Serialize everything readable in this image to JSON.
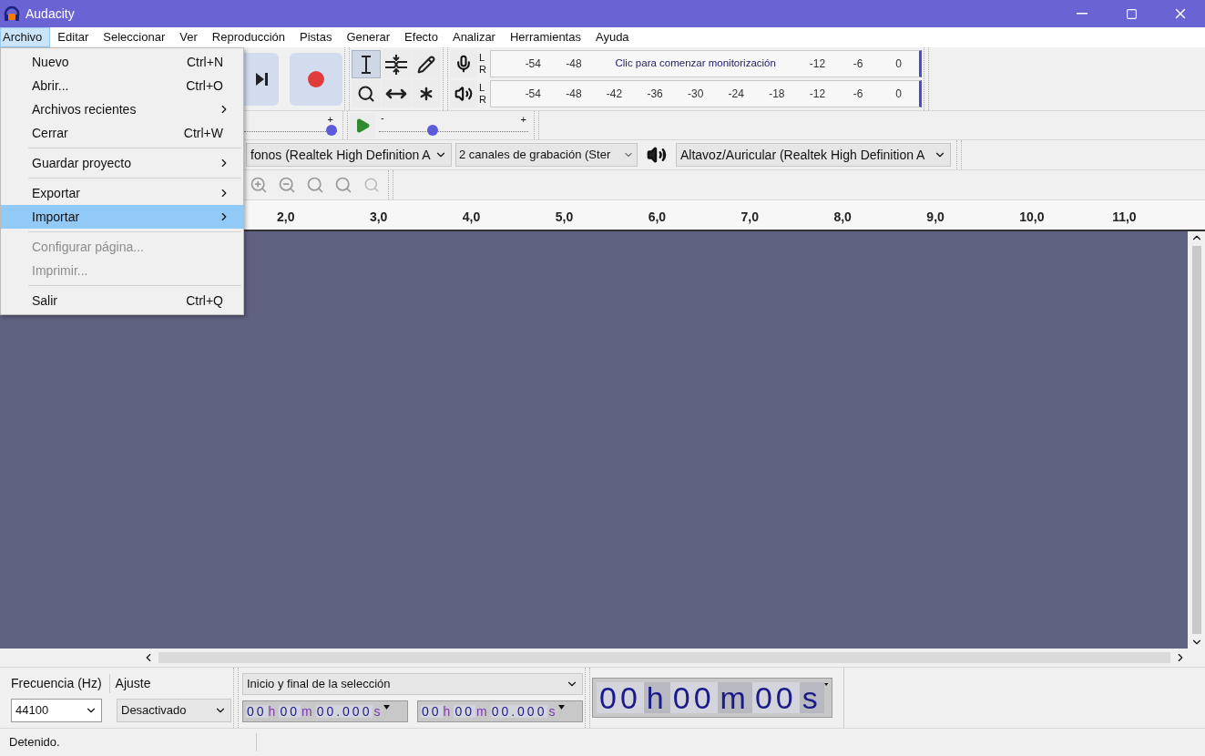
{
  "window": {
    "title": "Audacity"
  },
  "menubar": [
    {
      "label": "Archivo",
      "selected": true
    },
    {
      "label": "Editar",
      "selected": false
    },
    {
      "label": "Seleccionar",
      "selected": false
    },
    {
      "label": "Ver",
      "selected": false
    },
    {
      "label": "Reproducción",
      "selected": false
    },
    {
      "label": "Pistas",
      "selected": false
    },
    {
      "label": "Generar",
      "selected": false
    },
    {
      "label": "Efecto",
      "selected": false
    },
    {
      "label": "Analizar",
      "selected": false
    },
    {
      "label": "Herramientas",
      "selected": false
    },
    {
      "label": "Ayuda",
      "selected": false
    }
  ],
  "file_menu": [
    {
      "kind": "item",
      "label": "Nuevo",
      "shortcut": "Ctrl+N",
      "submenu": false,
      "disabled": false,
      "selected": false
    },
    {
      "kind": "item",
      "label": "Abrir...",
      "shortcut": "Ctrl+O",
      "submenu": false,
      "disabled": false,
      "selected": false
    },
    {
      "kind": "item",
      "label": "Archivos recientes",
      "submenu": true,
      "disabled": false,
      "selected": false
    },
    {
      "kind": "item",
      "label": "Cerrar",
      "shortcut": "Ctrl+W",
      "submenu": false,
      "disabled": false,
      "selected": false
    },
    {
      "kind": "separator"
    },
    {
      "kind": "item",
      "label": "Guardar proyecto",
      "submenu": true,
      "disabled": false,
      "selected": false
    },
    {
      "kind": "separator"
    },
    {
      "kind": "item",
      "label": "Exportar",
      "submenu": true,
      "disabled": false,
      "selected": false
    },
    {
      "kind": "item",
      "label": "Importar",
      "submenu": true,
      "disabled": false,
      "selected": true
    },
    {
      "kind": "separator"
    },
    {
      "kind": "item",
      "label": "Configurar página...",
      "submenu": false,
      "disabled": true,
      "selected": false
    },
    {
      "kind": "item",
      "label": "Imprimir...",
      "submenu": false,
      "disabled": true,
      "selected": false
    },
    {
      "kind": "separator"
    },
    {
      "kind": "item",
      "label": "Salir",
      "shortcut": "Ctrl+Q",
      "submenu": false,
      "disabled": false,
      "selected": false
    }
  ],
  "tools": [
    {
      "kind": "selection",
      "selected": true
    },
    {
      "kind": "envelope",
      "selected": false
    },
    {
      "kind": "draw",
      "selected": false
    },
    {
      "kind": "zoom",
      "selected": false
    },
    {
      "kind": "timeshift",
      "selected": false
    },
    {
      "kind": "multi",
      "selected": false
    }
  ],
  "meters": [
    {
      "kind": "record",
      "channels": [
        "L",
        "R"
      ],
      "ticks": [
        "-54",
        "-48"
      ],
      "hint": "Clic para comenzar monitorización",
      "ticks_end": [
        "-12",
        "-6",
        "0"
      ]
    },
    {
      "kind": "playback",
      "channels": [
        "L",
        "R"
      ],
      "ticks": [
        "-54",
        "-48",
        "-42",
        "-36",
        "-30",
        "-24",
        "-18",
        "-12",
        "-6",
        "0"
      ]
    }
  ],
  "record_slider": {
    "max_label": "+",
    "level": 1.0
  },
  "playback_slider": {
    "min_label": "-",
    "max_label": "+",
    "level": 0.34
  },
  "devices": {
    "recording": "fonos (Realtek High Definition A",
    "channels": "2 canales de grabación (Ster",
    "playback": "Altavoz/Auricular (Realtek High Definition A"
  },
  "ruler": [
    "2,0",
    "3,0",
    "4,0",
    "5,0",
    "6,0",
    "7,0",
    "8,0",
    "9,0",
    "10,0",
    "11,0"
  ],
  "selection_toolbar": {
    "rate_label": "Frecuencia (Hz)",
    "snap_label": "Ajuste",
    "rate": "44100",
    "snap": "Desactivado",
    "mode": "Inicio y final de la selección",
    "start": [
      {
        "text": "00",
        "kind": "digit"
      },
      {
        "text": "h",
        "kind": "unit"
      },
      {
        "text": "00",
        "kind": "digit"
      },
      {
        "text": "m",
        "kind": "unit"
      },
      {
        "text": "00.000",
        "kind": "digit"
      },
      {
        "text": "s",
        "kind": "unit"
      }
    ],
    "end": [
      {
        "text": "00",
        "kind": "digit"
      },
      {
        "text": "h",
        "kind": "unit"
      },
      {
        "text": "00",
        "kind": "digit"
      },
      {
        "text": "m",
        "kind": "unit"
      },
      {
        "text": "00.000",
        "kind": "digit"
      },
      {
        "text": "s",
        "kind": "unit"
      }
    ]
  },
  "time_display": [
    {
      "text": "00",
      "kind": "digit"
    },
    {
      "text": "h",
      "kind": "unit"
    },
    {
      "text": "00",
      "kind": "digit"
    },
    {
      "text": "m",
      "kind": "unit"
    },
    {
      "text": "00",
      "kind": "digit"
    },
    {
      "text": "s",
      "kind": "unit"
    }
  ],
  "status_bar": "Detenido."
}
